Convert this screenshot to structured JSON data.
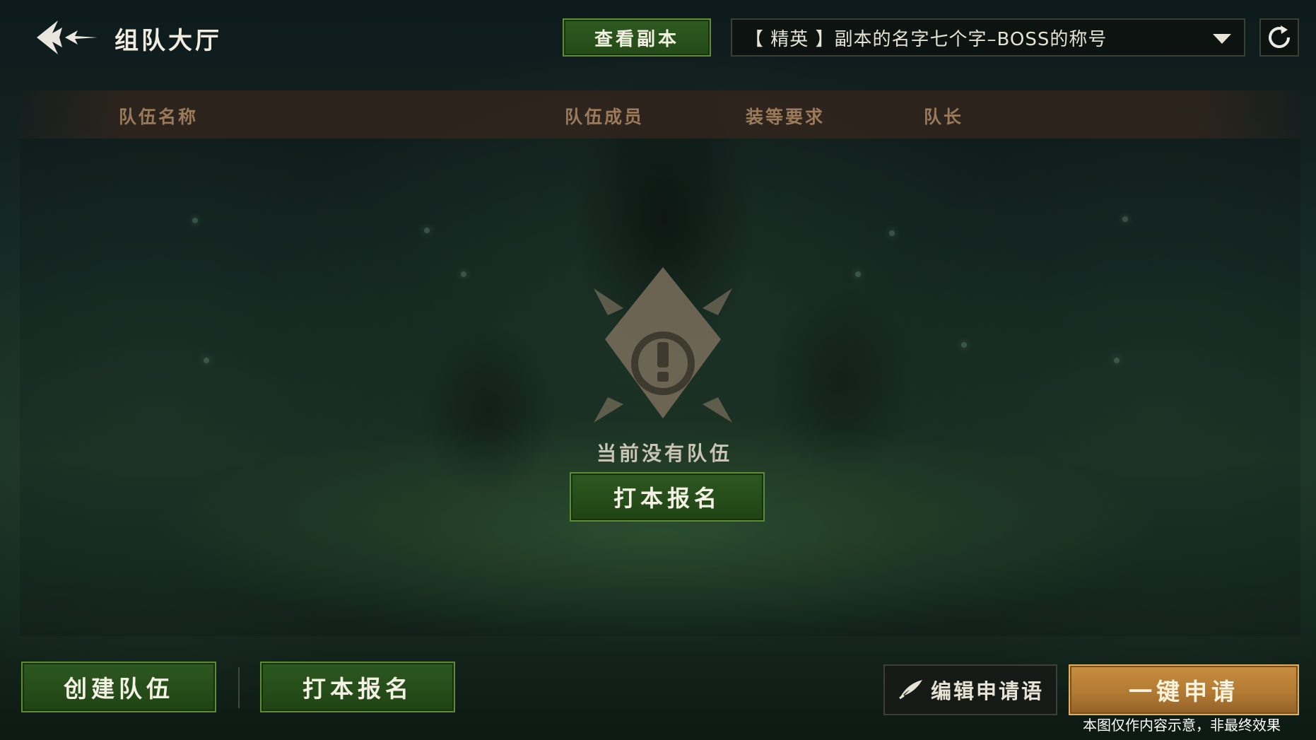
{
  "header": {
    "title": "组队大厅",
    "view_dungeon_label": "查看副本",
    "dungeon_select_value": "【 精英 】副本的名字七个字–BOSS的称号"
  },
  "table": {
    "columns": [
      "队伍名称",
      "队伍成员",
      "装等要求",
      "队长"
    ]
  },
  "empty_state": {
    "message": "当前没有队伍",
    "signup_label": "打本报名"
  },
  "bottom_bar": {
    "create_team_label": "创建队伍",
    "signup_label": "打本报名",
    "edit_message_label": "编辑申请语",
    "one_click_apply_label": "一键申请"
  },
  "disclaimer": "本图仅作内容示意，非最终效果",
  "icons": {
    "back": "back-arrow-icon",
    "dropdown": "chevron-down-icon",
    "refresh": "refresh-icon",
    "empty": "exclamation-emblem-icon",
    "edit": "quill-icon"
  },
  "colors": {
    "green_button": "#2d5820",
    "green_border": "#5c8c33",
    "gold_button": "#c98e40",
    "column_header_text": "#9a7a5a"
  }
}
